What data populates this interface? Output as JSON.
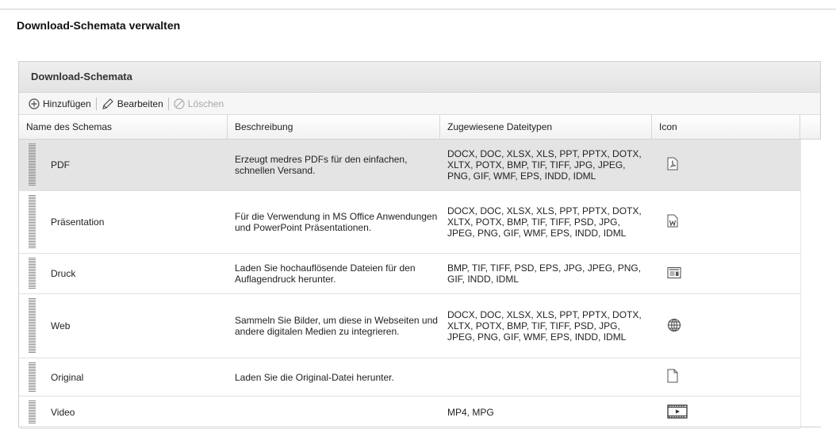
{
  "page": {
    "title": "Download-Schemata verwalten"
  },
  "panel": {
    "title": "Download-Schemata"
  },
  "toolbar": {
    "add_label": "Hinzufügen",
    "edit_label": "Bearbeiten",
    "delete_label": "Löschen"
  },
  "table": {
    "columns": [
      "Name des Schemas",
      "Beschreibung",
      "Zugewiesene Dateitypen",
      "Icon"
    ],
    "rows": [
      {
        "name": "PDF",
        "description": "Erzeugt medres PDFs für den einfachen, schnellen Versand.",
        "types": "DOCX, DOC, XLSX, XLS, PPT, PPTX, DOTX, XLTX, POTX, BMP, TIF, TIFF, JPG, JPEG, PNG, GIF, WMF, EPS, INDD, IDML",
        "icon": "pdf-file-icon",
        "selected": true
      },
      {
        "name": "Präsentation",
        "description": "Für die Verwendung in MS Office Anwendungen und PowerPoint Präsentationen.",
        "types": "DOCX, DOC, XLSX, XLS, PPT, PPTX, DOTX, XLTX, POTX, BMP, TIF, TIFF, PSD, JPG, JPEG, PNG, GIF, WMF, EPS, INDD, IDML",
        "icon": "word-file-icon",
        "selected": false
      },
      {
        "name": "Druck",
        "description": "Laden Sie hochauflösende Dateien für den Auflagendruck herunter.",
        "types": "BMP, TIF, TIFF, PSD, EPS, JPG, JPEG, PNG, GIF, INDD, IDML",
        "icon": "print-layout-icon",
        "selected": false
      },
      {
        "name": "Web",
        "description": "Sammeln Sie Bilder, um diese in Webseiten und andere digitalen Medien zu integrieren.",
        "types": "DOCX, DOC, XLSX, XLS, PPT, PPTX, DOTX, XLTX, POTX, BMP, TIF, TIFF, PSD, JPG, JPEG, PNG, GIF, WMF, EPS, INDD, IDML",
        "icon": "globe-icon",
        "selected": false
      },
      {
        "name": "Original",
        "description": "Laden Sie die Original-Datei herunter.",
        "types": "",
        "icon": "blank-file-icon",
        "selected": false
      },
      {
        "name": "Video",
        "description": "",
        "types": "MP4, MPG",
        "icon": "video-icon",
        "selected": false
      }
    ]
  }
}
